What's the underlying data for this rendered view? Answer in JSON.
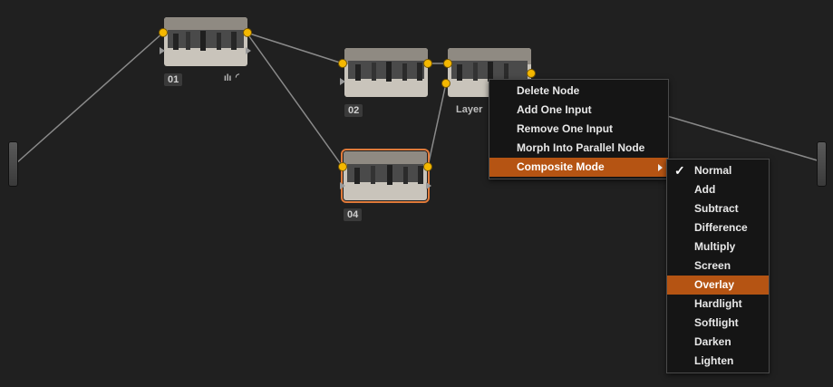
{
  "nodes": [
    {
      "id": "n01",
      "label": "01"
    },
    {
      "id": "n02",
      "label": "02"
    },
    {
      "id": "n04",
      "label": "04"
    },
    {
      "id": "layer",
      "label": "Layer"
    }
  ],
  "node01_tools": "ılı",
  "context_menu": {
    "items": [
      "Delete Node",
      "Add One Input",
      "Remove One Input",
      "Morph Into Parallel Node",
      "Composite Mode"
    ],
    "active_index": 4
  },
  "composite_submenu": {
    "items": [
      "Normal",
      "Add",
      "Subtract",
      "Difference",
      "Multiply",
      "Screen",
      "Overlay",
      "Hardlight",
      "Softlight",
      "Darken",
      "Lighten"
    ],
    "checked": "Normal",
    "highlighted": "Overlay"
  },
  "colors": {
    "accent": "#b55413",
    "port": "#f5b800",
    "selection": "#e07a3a"
  }
}
